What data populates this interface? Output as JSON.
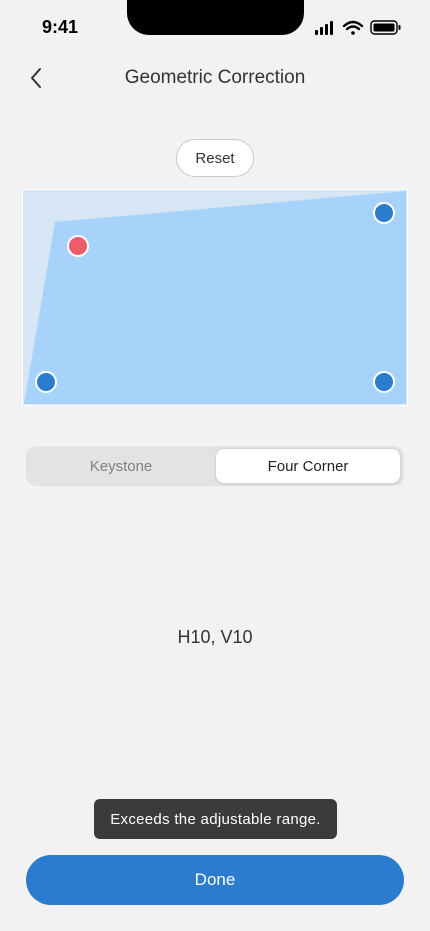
{
  "status_bar": {
    "time": "9:41"
  },
  "nav": {
    "title": "Geometric Correction",
    "back_icon": "chevron-left-icon"
  },
  "reset_label": "Reset",
  "preview": {
    "frame_color": "#d6e6f4",
    "area_color": "#a7d3fb",
    "handle_color": "#2a7ccf",
    "active_handle_color": "#ec5c6c",
    "active_corner": "top-left"
  },
  "segment": {
    "options": [
      "Keystone",
      "Four Corner"
    ],
    "selected": "Four Corner"
  },
  "value_text": "H10, V10",
  "toast": "Exceeds the adjustable range.",
  "done_label": "Done",
  "accent_color": "#2b7bcf"
}
